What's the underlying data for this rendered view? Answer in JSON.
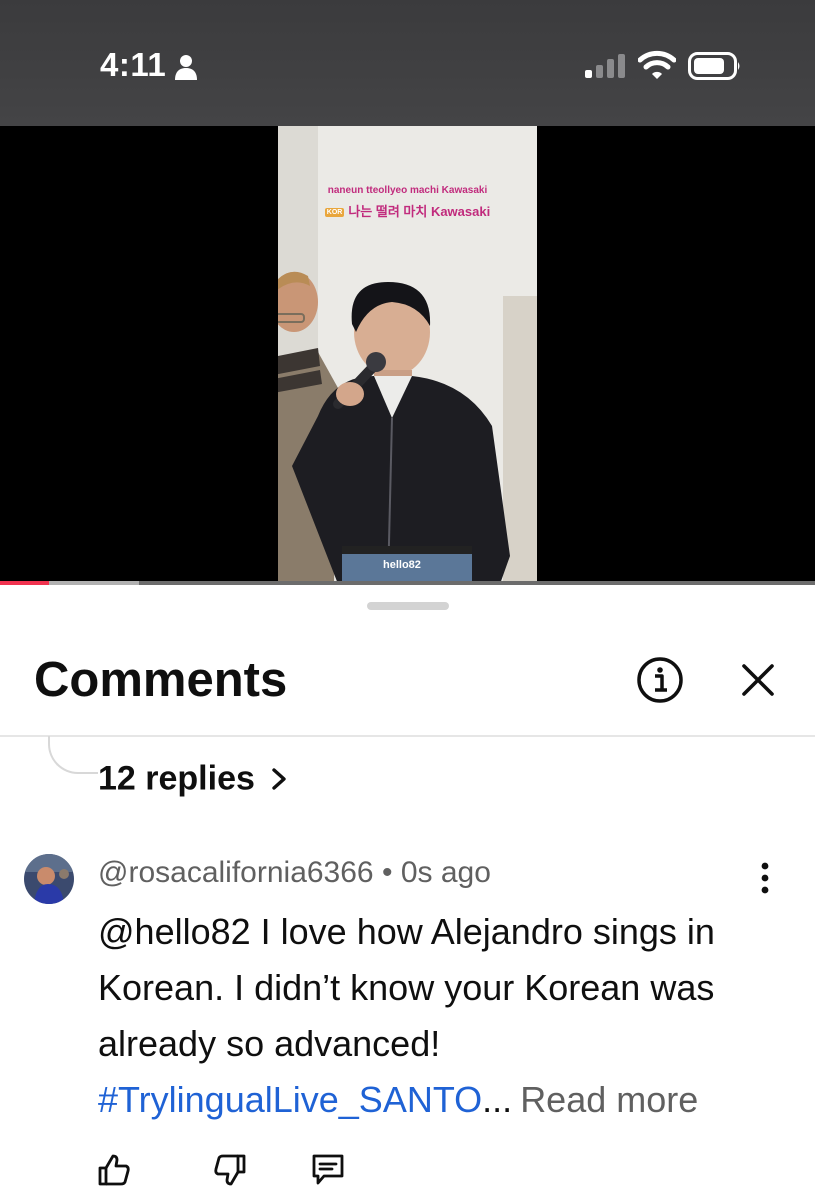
{
  "status_bar": {
    "time": "4:11",
    "icons": [
      "person-icon",
      "signal-icon",
      "wifi-icon",
      "battery-icon"
    ]
  },
  "video": {
    "lyrics_romanized": "naneun tteollyeo machi Kawasaki",
    "lyrics_tag": "KOR",
    "lyrics_korean": "나는 떨려 마치 Kawasaki",
    "watermark": "hello82",
    "progress_fraction": 0.06,
    "buffered_fraction": 0.17,
    "colors": {
      "progress": "#f0334f",
      "lyrics": "#c12b7d"
    }
  },
  "comments_panel": {
    "title": "Comments",
    "info_icon": "info-icon",
    "close_icon": "close-icon",
    "thread": {
      "replies_label": "12 replies"
    },
    "comment": {
      "author": "@rosacalifornia6366",
      "separator": "•",
      "timestamp": "0s ago",
      "text": "@hello82 I love how Alejandro sings in Korean. I didn’t know your Korean was already so advanced!",
      "hashtag": "#TrylingualLive_SANTO",
      "ellipsis": "...",
      "read_more": "Read more",
      "actions": [
        "thumbs-up-icon",
        "thumbs-down-icon",
        "reply-icon"
      ],
      "colors": {
        "hashtag": "#1f62d5",
        "meta": "#606060"
      }
    }
  }
}
